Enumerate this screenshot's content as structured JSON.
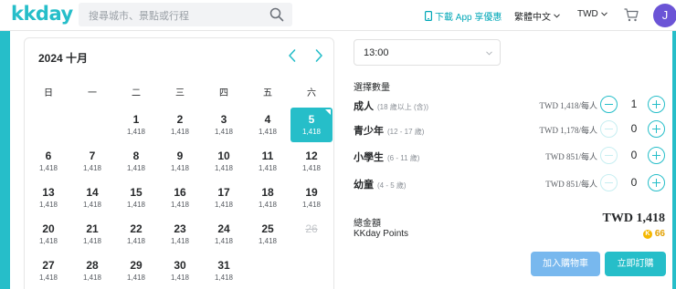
{
  "header": {
    "logo": "kkday",
    "search_placeholder": "搜尋城市、景點或行程",
    "download_label": "下載 App 享優惠",
    "language_label": "繁體中文",
    "currency_label": "TWD",
    "avatar_initial": "J",
    "icons": [
      "search-icon",
      "phone-icon",
      "chevron-down-icon",
      "cart-icon"
    ]
  },
  "calendar": {
    "title": "2024 十月",
    "weekdays": [
      "日",
      "一",
      "二",
      "三",
      "四",
      "五",
      "六"
    ],
    "days": [
      {
        "d": "1",
        "p": "1,418"
      },
      {
        "d": "2",
        "p": "1,418"
      },
      {
        "d": "3",
        "p": "1,418"
      },
      {
        "d": "4",
        "p": "1,418"
      },
      {
        "d": "5",
        "p": "1,418"
      },
      {
        "d": "6",
        "p": "1,418"
      },
      {
        "d": "7",
        "p": "1,418"
      },
      {
        "d": "8",
        "p": "1,418"
      },
      {
        "d": "9",
        "p": "1,418"
      },
      {
        "d": "10",
        "p": "1,418"
      },
      {
        "d": "11",
        "p": "1,418"
      },
      {
        "d": "12",
        "p": "1,418"
      },
      {
        "d": "13",
        "p": "1,418"
      },
      {
        "d": "14",
        "p": "1,418"
      },
      {
        "d": "15",
        "p": "1,418"
      },
      {
        "d": "16",
        "p": "1,418"
      },
      {
        "d": "17",
        "p": "1,418"
      },
      {
        "d": "18",
        "p": "1,418"
      },
      {
        "d": "19",
        "p": "1,418"
      },
      {
        "d": "20",
        "p": "1,418"
      },
      {
        "d": "21",
        "p": "1,418"
      },
      {
        "d": "22",
        "p": "1,418"
      },
      {
        "d": "23",
        "p": "1,418"
      },
      {
        "d": "24",
        "p": "1,418"
      },
      {
        "d": "25",
        "p": "1,418"
      },
      {
        "d": "26",
        "p": ""
      },
      {
        "d": "27",
        "p": "1,418"
      },
      {
        "d": "28",
        "p": "1,418"
      },
      {
        "d": "29",
        "p": "1,418"
      },
      {
        "d": "30",
        "p": "1,418"
      },
      {
        "d": "31",
        "p": "1,418"
      }
    ],
    "first_weekday_index": 2,
    "selected_day": "5",
    "unavailable_days": [
      "26"
    ]
  },
  "booking": {
    "time_value": "13:00",
    "quantity_heading": "選擇數量",
    "rows": [
      {
        "label": "成人",
        "age": "(18 歲以上 (含))",
        "price": "TWD 1,418/每人",
        "count": "1"
      },
      {
        "label": "青少年",
        "age": "(12 - 17 歲)",
        "price": "TWD 1,178/每人",
        "count": "0"
      },
      {
        "label": "小學生",
        "age": "(6 - 11 歲)",
        "price": "TWD 851/每人",
        "count": "0"
      },
      {
        "label": "幼童",
        "age": "(4 - 5 歲)",
        "price": "TWD 851/每人",
        "count": "0"
      }
    ],
    "total_label": "總金額",
    "total_value": "TWD 1,418",
    "points_label": "KKday Points",
    "points_value": "66",
    "add_to_cart_label": "加入購物車",
    "buy_now_label": "立即訂購"
  },
  "colors": {
    "brand": "#26bec9",
    "cart_button": "#78b8ee",
    "points": "#e3a100",
    "avatar": "#6b54d6"
  }
}
